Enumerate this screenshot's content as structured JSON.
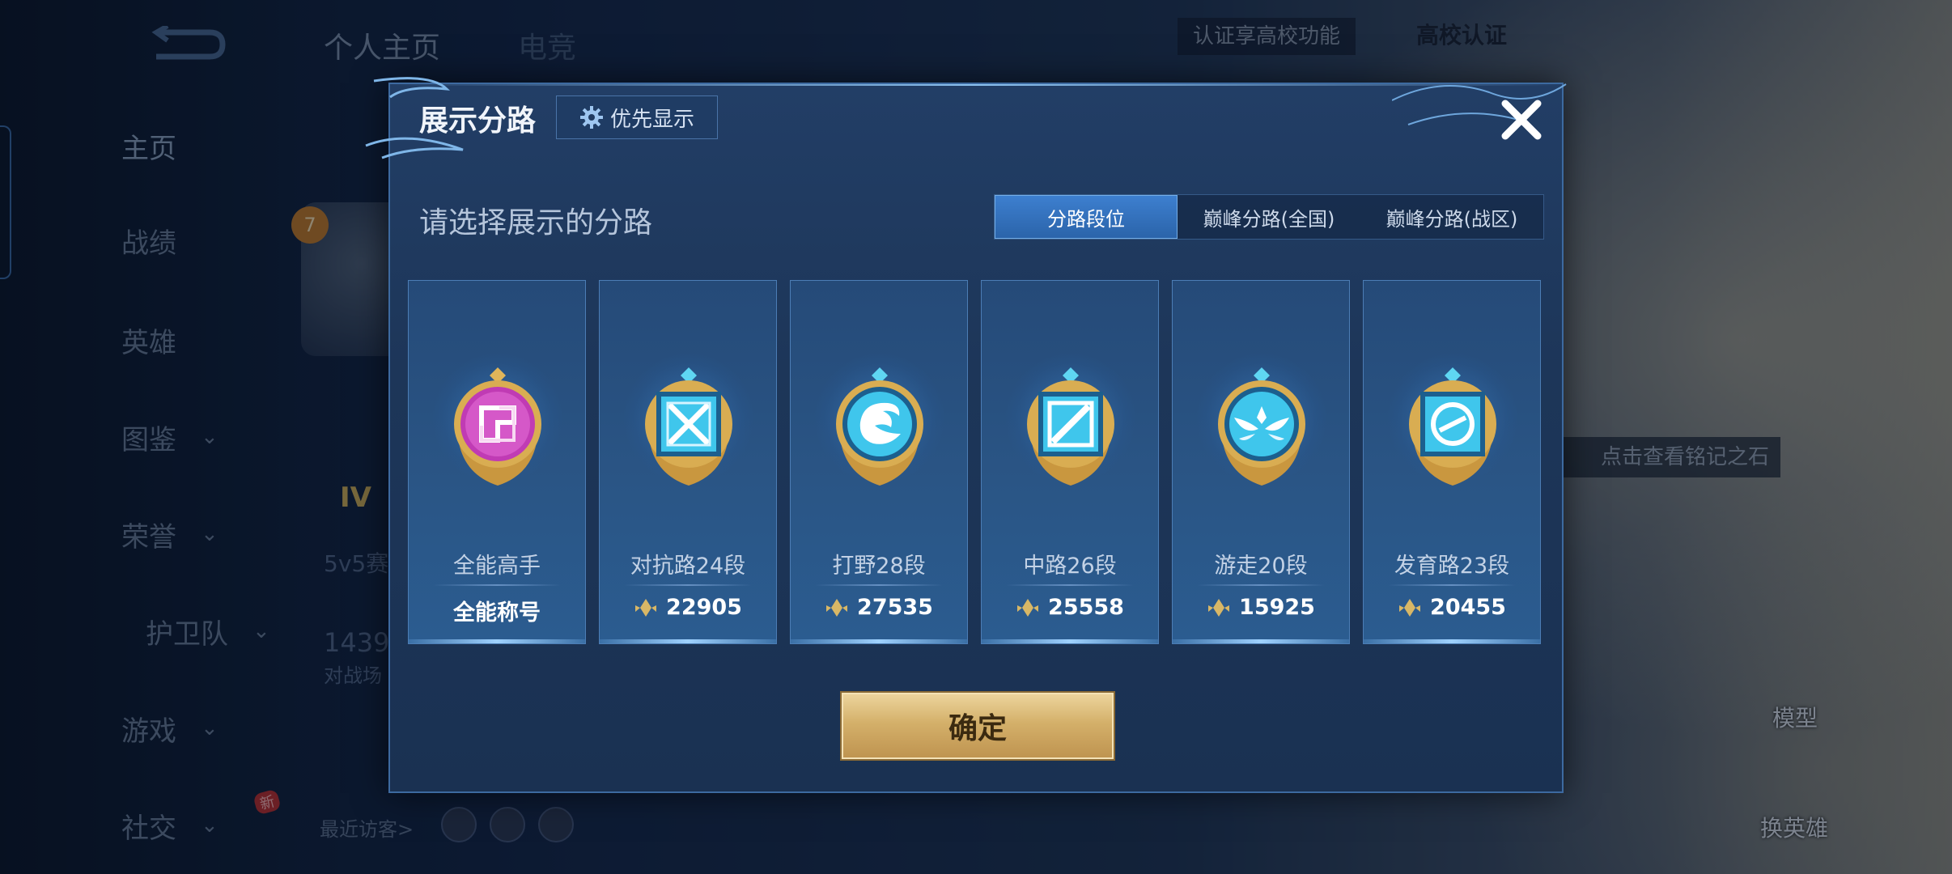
{
  "background": {
    "nav_items": [
      {
        "label": "主页",
        "chevron": false
      },
      {
        "label": "战绩",
        "chevron": false
      },
      {
        "label": "英雄",
        "chevron": false
      },
      {
        "label": "图鉴",
        "chevron": true
      },
      {
        "label": "荣誉",
        "chevron": true
      },
      {
        "label": "护卫队",
        "chevron": true
      },
      {
        "label": "游戏",
        "chevron": true
      },
      {
        "label": "社交",
        "chevron": true
      }
    ],
    "new_badge": "新",
    "top_tabs": [
      "个人主页",
      "电竞"
    ],
    "level": "7",
    "mode_text": "5v5赛",
    "match_count": "1439",
    "match_label": "对战场",
    "cert_button": "认证享高校功能",
    "cert_text": "高校认证",
    "side_tip": "点击查看铭记之石",
    "model_label": "模型",
    "swap_label": "换英雄",
    "recent_visitors": "最近访客>"
  },
  "modal": {
    "title": "展示分路",
    "priority_label": "优先显示",
    "section_title": "请选择展示的分路",
    "tabs": [
      {
        "label": "分路段位",
        "active": true
      },
      {
        "label": "巅峰分路(全国)",
        "active": false
      },
      {
        "label": "巅峰分路(战区)",
        "active": false
      }
    ],
    "cards": [
      {
        "label": "全能高手",
        "value": "全能称号",
        "icon": "all-rounder-emblem-icon",
        "has_points": false
      },
      {
        "label": "对抗路24段",
        "value": "22905",
        "icon": "clash-lane-emblem-icon",
        "has_points": true
      },
      {
        "label": "打野28段",
        "value": "27535",
        "icon": "jungle-emblem-icon",
        "has_points": true
      },
      {
        "label": "中路26段",
        "value": "25558",
        "icon": "mid-lane-emblem-icon",
        "has_points": true
      },
      {
        "label": "游走20段",
        "value": "15925",
        "icon": "roam-emblem-icon",
        "has_points": true
      },
      {
        "label": "发育路23段",
        "value": "20455",
        "icon": "farm-lane-emblem-icon",
        "has_points": true
      }
    ],
    "confirm_label": "确定"
  },
  "colors": {
    "modal_bg": "#1d3659",
    "tab_active": "#2b64aa",
    "emblem_gold": "#d9ad52",
    "emblem_cyan": "#3fc6ec",
    "emblem_magenta": "#c03bb4",
    "confirm_gold": "#d4b06a"
  }
}
